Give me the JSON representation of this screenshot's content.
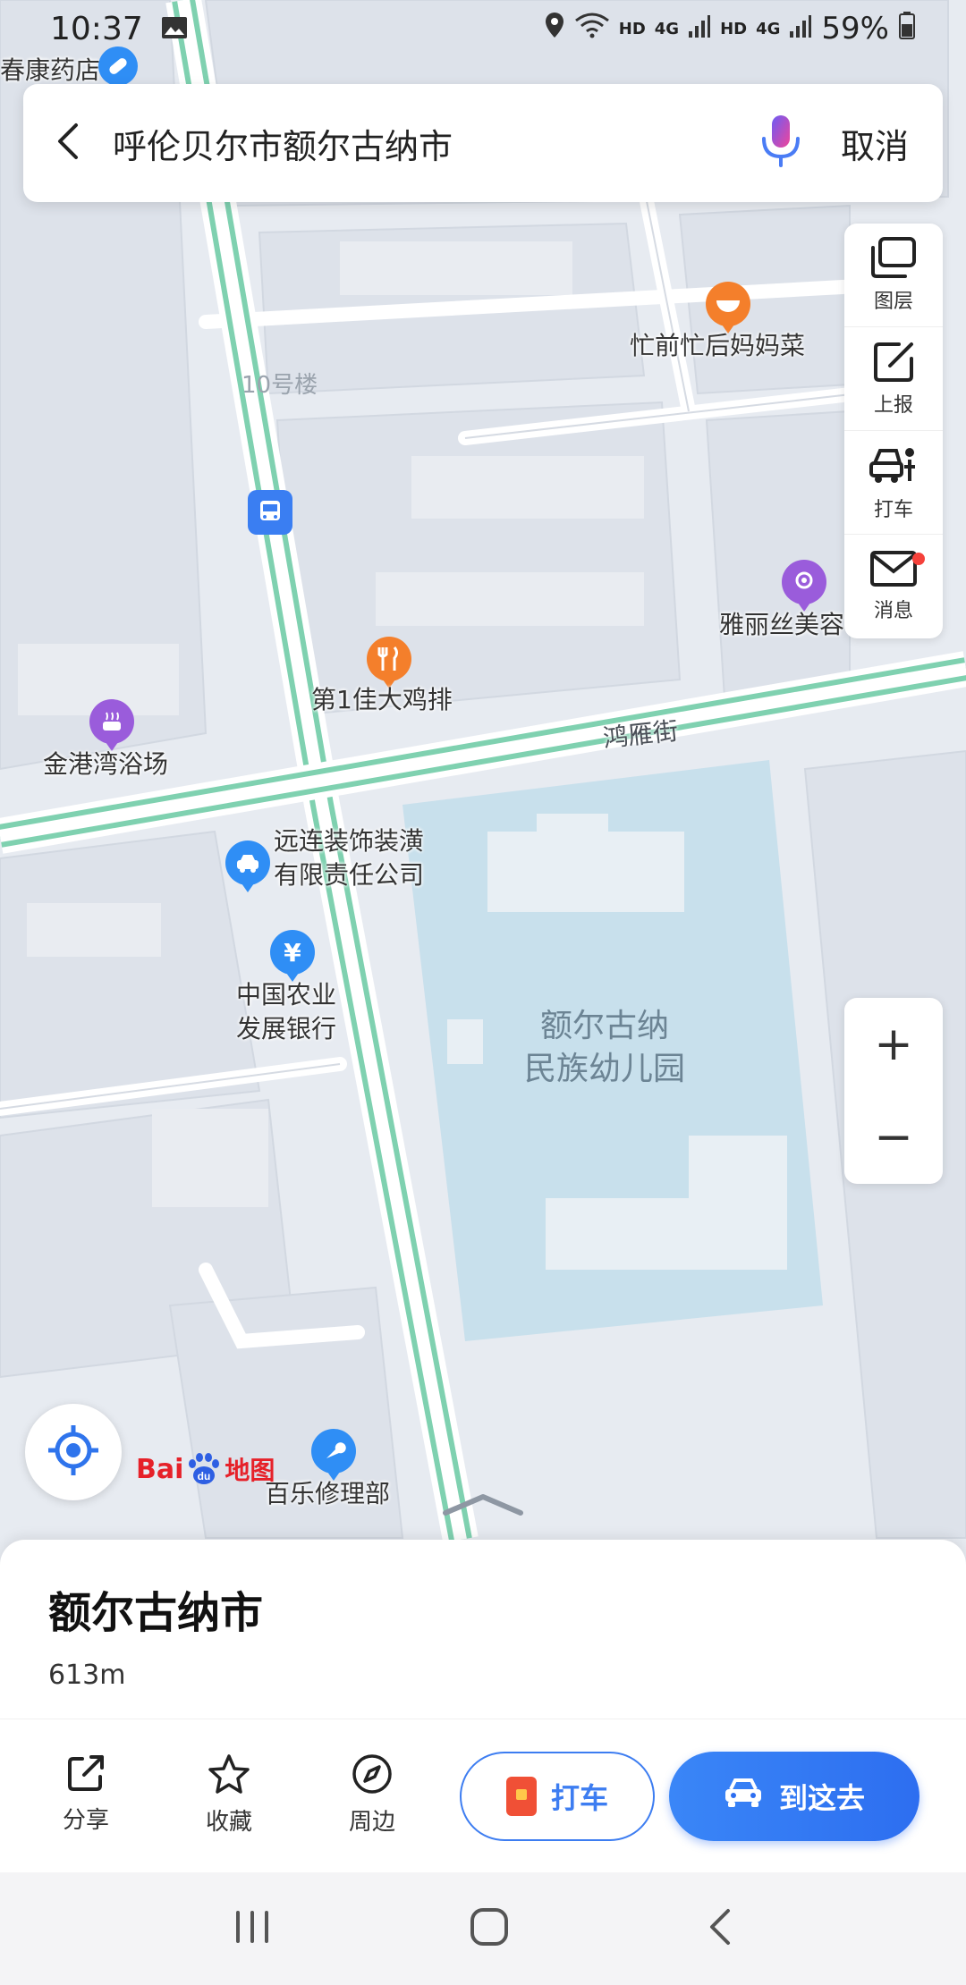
{
  "status_bar": {
    "time": "10:37",
    "network_label_1": "HD",
    "network_label_2": "4G",
    "network_label_3": "HD",
    "network_label_4": "4G",
    "battery": "59%"
  },
  "search": {
    "query": "呼伦贝尔市额尔古纳市",
    "cancel_label": "取消"
  },
  "map": {
    "top_left_poi": "春康药店",
    "building_label": "10号楼",
    "street_name": "鸿雁街",
    "area_name_line1": "额尔古纳",
    "area_name_line2": "民族幼儿园",
    "pois": [
      {
        "name": "忙前忙后妈妈菜",
        "icon": "restaurant-icon"
      },
      {
        "name": "雅丽丝美容",
        "icon": "beauty-icon"
      },
      {
        "name": "第1佳大鸡排",
        "icon": "food-icon"
      },
      {
        "name": "金港湾浴场",
        "icon": "bath-icon"
      },
      {
        "name_line1": "远连装饰装潢",
        "name_line2": "有限责任公司",
        "icon": "company-icon"
      },
      {
        "name_line1": "中国农业",
        "name_line2": "发展银行",
        "icon": "bank-icon"
      },
      {
        "name": "百乐修理部",
        "icon": "repair-icon"
      }
    ]
  },
  "tools": [
    {
      "label": "图层",
      "icon": "layers-icon"
    },
    {
      "label": "上报",
      "icon": "report-icon"
    },
    {
      "label": "打车",
      "icon": "taxi-icon"
    },
    {
      "label": "消息",
      "icon": "message-icon"
    }
  ],
  "zoom": {
    "plus": "+",
    "minus": "−"
  },
  "logo": {
    "bai": "Bai",
    "du": "du",
    "ditu": "地图"
  },
  "place": {
    "title": "额尔古纳市",
    "distance": "613m"
  },
  "actions": {
    "share": "分享",
    "favorite": "收藏",
    "nearby": "周边",
    "taxi": "打车",
    "go": "到这去"
  },
  "colors": {
    "accent": "#3d7df1",
    "road_green": "#7fd1b0",
    "kindergarten": "#c8e0ec"
  }
}
